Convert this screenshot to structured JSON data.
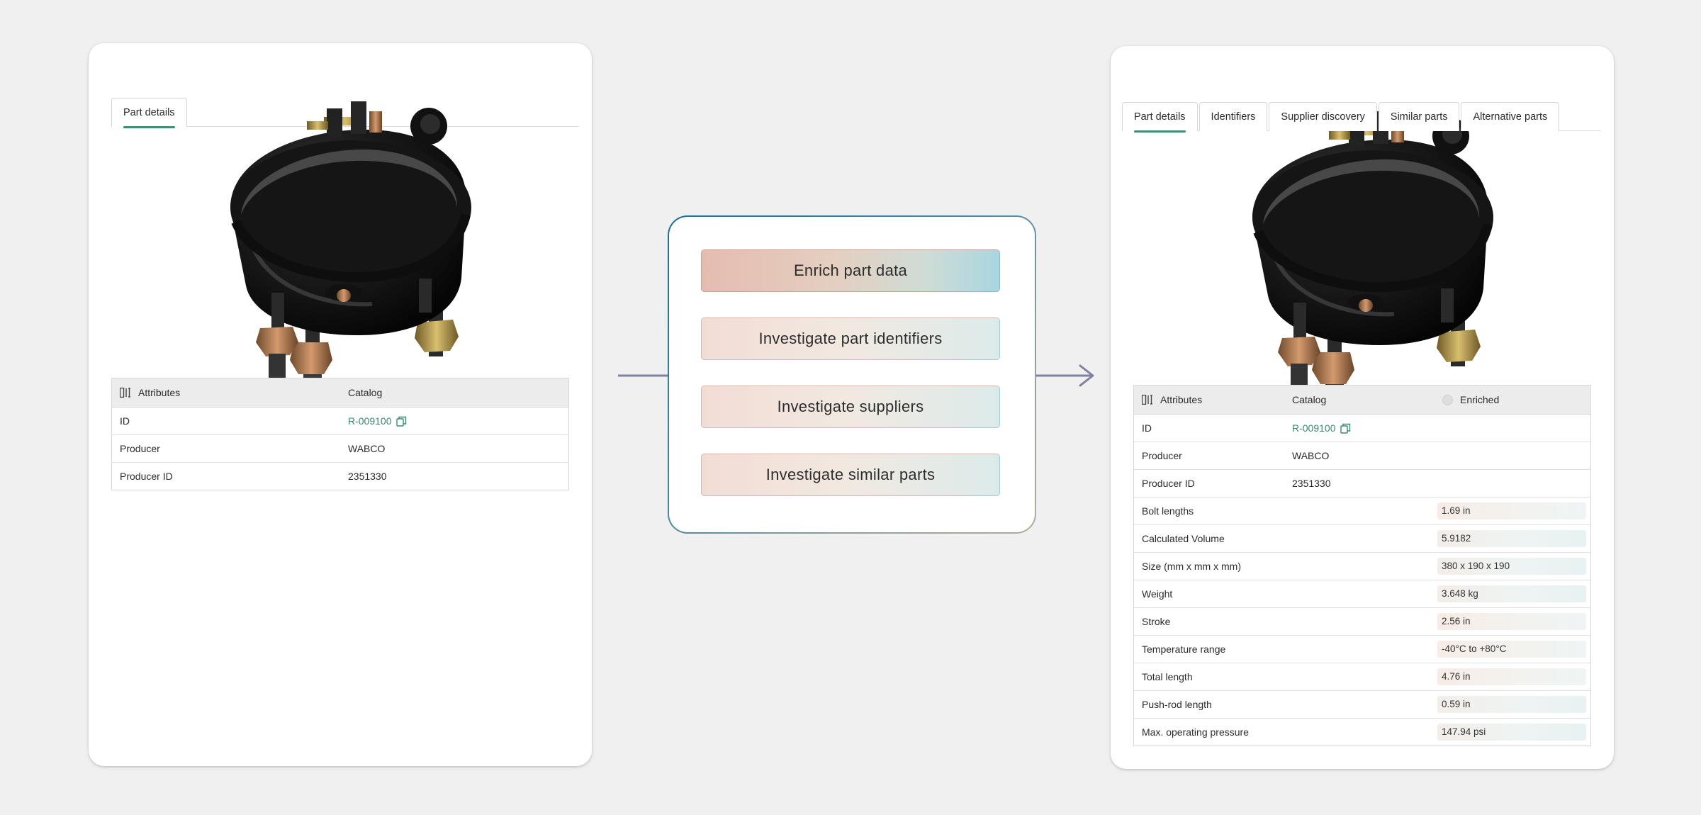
{
  "left_panel": {
    "tabs": [
      {
        "label": "Part details",
        "active": true
      }
    ],
    "table": {
      "headers": [
        "Attributes",
        "Catalog"
      ],
      "rows": [
        {
          "label": "ID",
          "catalog": "R-009100"
        },
        {
          "label": "Producer",
          "catalog": "WABCO"
        },
        {
          "label": "Producer ID",
          "catalog": "2351330"
        }
      ]
    }
  },
  "center_panel": {
    "actions": [
      "Enrich part data",
      "Investigate part identifiers",
      "Investigate suppliers",
      "Investigate similar parts"
    ]
  },
  "right_panel": {
    "tabs": [
      {
        "label": "Part details",
        "active": true
      },
      {
        "label": "Identifiers"
      },
      {
        "label": "Supplier discovery"
      },
      {
        "label": "Similar parts"
      },
      {
        "label": "Alternative parts"
      }
    ],
    "table": {
      "headers": [
        "Attributes",
        "Catalog",
        "Enriched"
      ],
      "rows": [
        {
          "label": "ID",
          "catalog": "R-009100",
          "enriched": ""
        },
        {
          "label": "Producer",
          "catalog": "WABCO",
          "enriched": ""
        },
        {
          "label": "Producer ID",
          "catalog": "2351330",
          "enriched": ""
        },
        {
          "label": "Bolt lengths",
          "catalog": "",
          "enriched": "1.69 in"
        },
        {
          "label": "Calculated Volume",
          "catalog": "",
          "enriched": "5.9182"
        },
        {
          "label": "Size (mm x mm x mm)",
          "catalog": "",
          "enriched": "380 x 190 x 190"
        },
        {
          "label": "Weight",
          "catalog": "",
          "enriched": "3.648 kg"
        },
        {
          "label": "Stroke",
          "catalog": "",
          "enriched": "2.56 in"
        },
        {
          "label": "Temperature range",
          "catalog": "",
          "enriched": "-40°C to +80°C"
        },
        {
          "label": "Total length",
          "catalog": "",
          "enriched": "4.76 in"
        },
        {
          "label": "Push-rod length",
          "catalog": "",
          "enriched": "0.59 in"
        },
        {
          "label": "Max. operating pressure",
          "catalog": "",
          "enriched": "147.94 psi"
        }
      ]
    }
  },
  "colors": {
    "accent": "#3e8f72",
    "link": "#3a8a6e",
    "panel_border_start": "#1d6fa0",
    "panel_border_end": "#b3ad9a",
    "connector": "#8080a0"
  },
  "icons": [
    "columns-icon",
    "copy-icon",
    "arrow-right-icon",
    "brake-chamber-image"
  ]
}
